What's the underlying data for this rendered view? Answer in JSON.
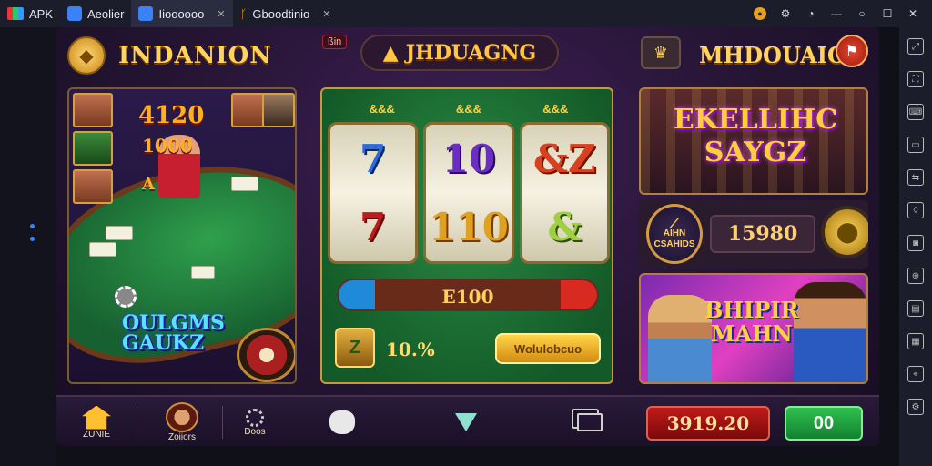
{
  "titlebar": {
    "app_label": "APK",
    "tabs": [
      {
        "label": "Aeolier"
      },
      {
        "label": "Iioooooo"
      },
      {
        "label": "Gboodtinio"
      }
    ]
  },
  "topbar": {
    "left_title": "INDANION",
    "small_tag": "ßin",
    "center_title": "JHDUAGNG",
    "right_title": "MHDOUAIOA"
  },
  "left_panel": {
    "numbers": [
      "4120",
      "1000",
      "A"
    ],
    "logo_line1": "OULGMS",
    "logo_line2": "GAUKZ"
  },
  "slot": {
    "top_labels": [
      "&&&",
      "&&&",
      "&&&"
    ],
    "reels": [
      {
        "top": "7",
        "bottom": "7"
      },
      {
        "top": "10",
        "bottom": "110"
      },
      {
        "top": "&Z",
        "bottom": "&"
      }
    ],
    "progress_label": "E100",
    "icon_letter": "Z",
    "percent": "10.%",
    "button_label": "Wolulobcuo"
  },
  "right_panel": {
    "banner_line1": "EKELLIHC",
    "banner_line2": "SAYGZ",
    "badge_line1": "AIHN",
    "badge_line2": "CSAHIDS",
    "value": "15980",
    "promo_line1": "BHIPIR",
    "promo_line2": "MAHN"
  },
  "bottombar": {
    "home_label": "ZUNIE",
    "profile_label": "Zoiiors",
    "chips_label": "Doos",
    "balance": "3919.20",
    "go_label": "00"
  },
  "colors": {
    "accent_gold": "#ffd35c",
    "felt_green": "#2fa04c",
    "balance_red": "#c01a1a",
    "go_green": "#30c050"
  }
}
